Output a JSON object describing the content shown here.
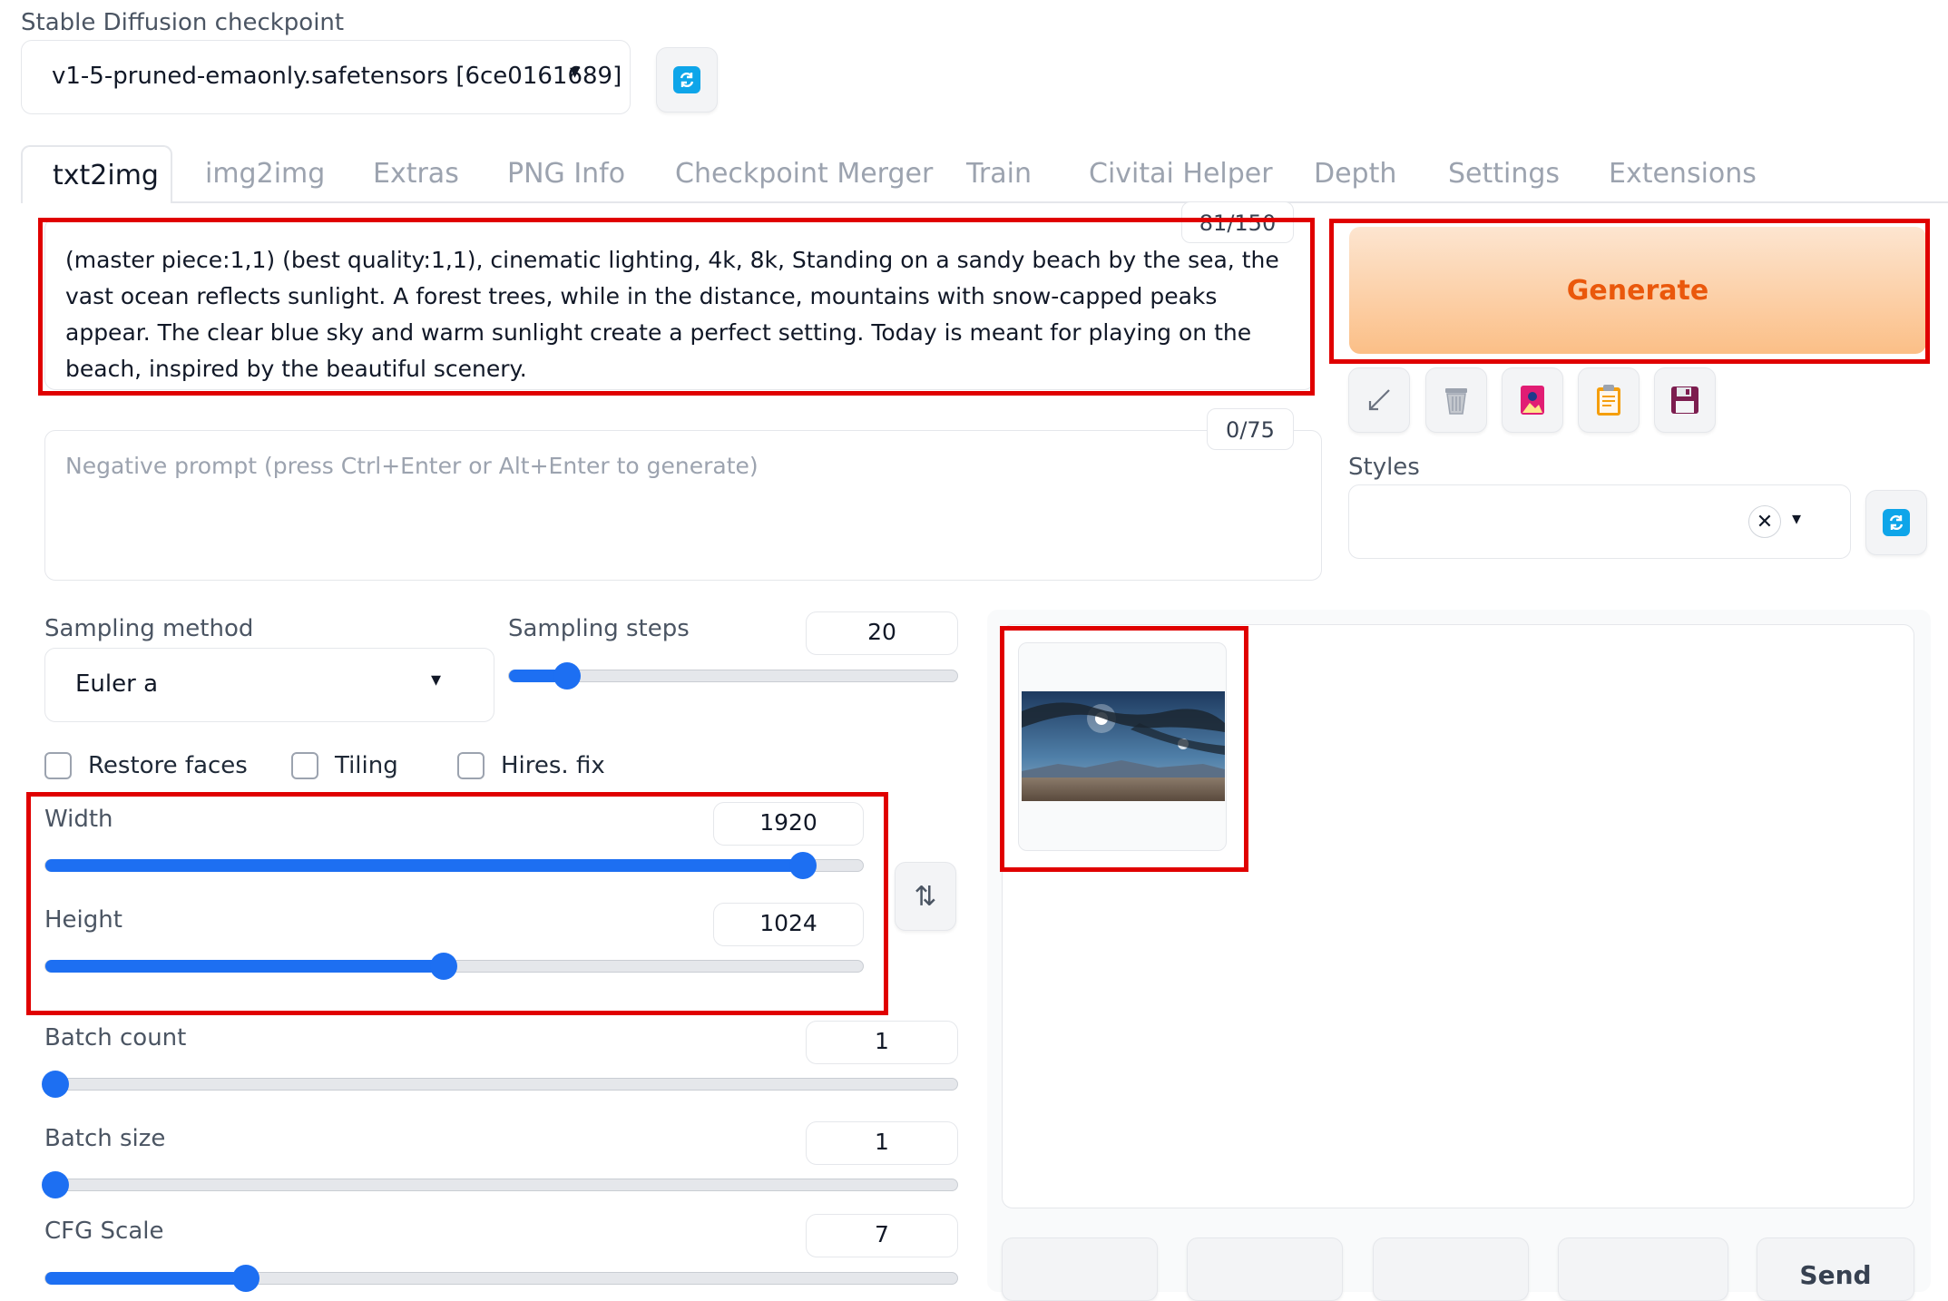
{
  "checkpoint": {
    "label": "Stable Diffusion checkpoint",
    "value": "v1-5-pruned-emaonly.safetensors [6ce0161689]"
  },
  "tabs": [
    {
      "label": "txt2img",
      "active": true
    },
    {
      "label": "img2img"
    },
    {
      "label": "Extras"
    },
    {
      "label": "PNG Info"
    },
    {
      "label": "Checkpoint Merger"
    },
    {
      "label": "Train"
    },
    {
      "label": "Civitai Helper"
    },
    {
      "label": "Depth"
    },
    {
      "label": "Settings"
    },
    {
      "label": "Extensions"
    }
  ],
  "prompt": {
    "token_count": "81/150",
    "text": "(master piece:1,1) (best quality:1,1), cinematic lighting, 4k, 8k, Standing on a sandy beach by the sea, the vast ocean reflects sunlight. A forest trees, while in the distance, mountains with snow-capped peaks appear. The clear blue sky and warm sunlight create a perfect setting.  Today is meant for playing on the beach, inspired by the beautiful scenery."
  },
  "negative_prompt": {
    "token_count": "0/75",
    "placeholder": "Negative prompt (press Ctrl+Enter or Alt+Enter to generate)"
  },
  "generate": {
    "label": "Generate"
  },
  "styles": {
    "label": "Styles",
    "clear_glyph": "✕"
  },
  "sampling": {
    "method_label": "Sampling method",
    "method_value": "Euler a",
    "steps_label": "Sampling steps",
    "steps_value": "20",
    "steps_fraction": 0.13
  },
  "checkboxes": {
    "restore_faces": "Restore faces",
    "tiling": "Tiling",
    "hires_fix": "Hires. fix"
  },
  "dimensions": {
    "width_label": "Width",
    "width_value": "1920",
    "width_fraction": 0.927,
    "height_label": "Height",
    "height_value": "1024",
    "height_fraction": 0.487,
    "swap_glyph": "⇅"
  },
  "batch": {
    "count_label": "Batch count",
    "count_value": "1",
    "count_fraction": 0.0,
    "size_label": "Batch size",
    "size_value": "1",
    "size_fraction": 0.0
  },
  "cfg": {
    "label": "CFG Scale",
    "value": "7",
    "fraction": 0.22
  },
  "output": {
    "send_label": "Send"
  },
  "colors": {
    "accent": "#1d6ff2",
    "generate_text": "#ea580c",
    "highlight": "#e00000"
  }
}
